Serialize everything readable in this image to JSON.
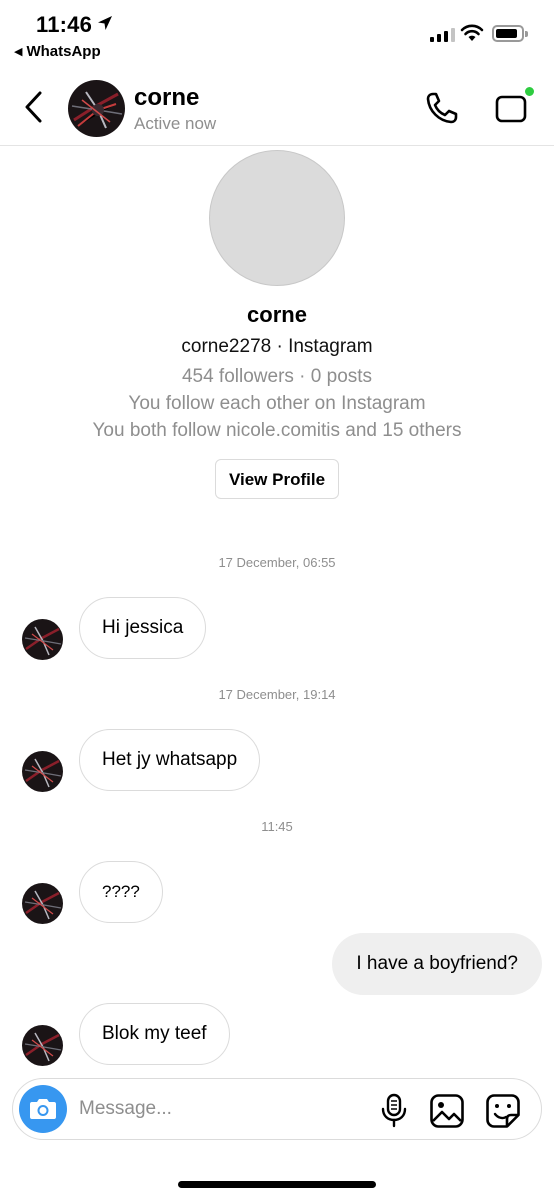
{
  "status_bar": {
    "time": "11:46",
    "back_app": "WhatsApp"
  },
  "header": {
    "name": "corne",
    "status": "Active now"
  },
  "profile": {
    "name": "corne",
    "handle_line": "corne2278 · Instagram",
    "stats": "454 followers · 0 posts",
    "mutual_line_1": "You follow each other on Instagram",
    "mutual_line_2": "You both follow nicole.comitis and 15 others",
    "view_profile_label": "View Profile"
  },
  "messages": [
    {
      "type": "timestamp",
      "text": "17 December, 06:55"
    },
    {
      "type": "incoming",
      "text": "Hi jessica"
    },
    {
      "type": "timestamp",
      "text": "17 December, 19:14"
    },
    {
      "type": "incoming",
      "text": "Het jy whatsapp"
    },
    {
      "type": "timestamp",
      "text": "11:45"
    },
    {
      "type": "incoming",
      "text": "????"
    },
    {
      "type": "outgoing",
      "text": "I have a boyfriend?"
    },
    {
      "type": "incoming",
      "text": "Blok my teef"
    }
  ],
  "composer": {
    "placeholder": "Message..."
  },
  "icons": {
    "back": "chevron-left-icon",
    "call": "phone-icon",
    "video": "video-camera-icon",
    "camera": "camera-icon",
    "mic": "microphone-icon",
    "gallery": "image-icon",
    "sticker": "sticker-icon"
  },
  "colors": {
    "accent_blue": "#3797f0",
    "active_green": "#2ecc40",
    "muted_text": "#8e8e8e",
    "outgoing_bubble": "#efefef",
    "border": "#dbdbdb"
  }
}
